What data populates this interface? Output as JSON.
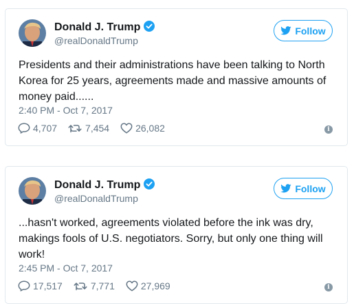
{
  "tweets": [
    {
      "name": "Donald J. Trump",
      "handle": "@realDonaldTrump",
      "follow_label": "Follow",
      "text": "Presidents and their administrations have been talking to North Korea for 25 years, agreements made and massive amounts of money paid......",
      "timestamp": "2:40 PM - Oct 7, 2017",
      "replies": "4,707",
      "retweets": "7,454",
      "likes": "26,082"
    },
    {
      "name": "Donald J. Trump",
      "handle": "@realDonaldTrump",
      "follow_label": "Follow",
      "text": "...hasn't worked, agreements violated before the ink was dry, makings fools of U.S. negotiators. Sorry, but only one thing will work!",
      "timestamp": "2:45 PM - Oct 7, 2017",
      "replies": "17,517",
      "retweets": "7,771",
      "likes": "27,969"
    }
  ],
  "colors": {
    "accent": "#1da1f2",
    "text": "#14171a",
    "muted": "#657786",
    "border": "#e1e8ed"
  },
  "icons": [
    "verified-badge-icon",
    "twitter-bird-icon",
    "reply-icon",
    "retweet-icon",
    "like-icon",
    "info-icon"
  ]
}
